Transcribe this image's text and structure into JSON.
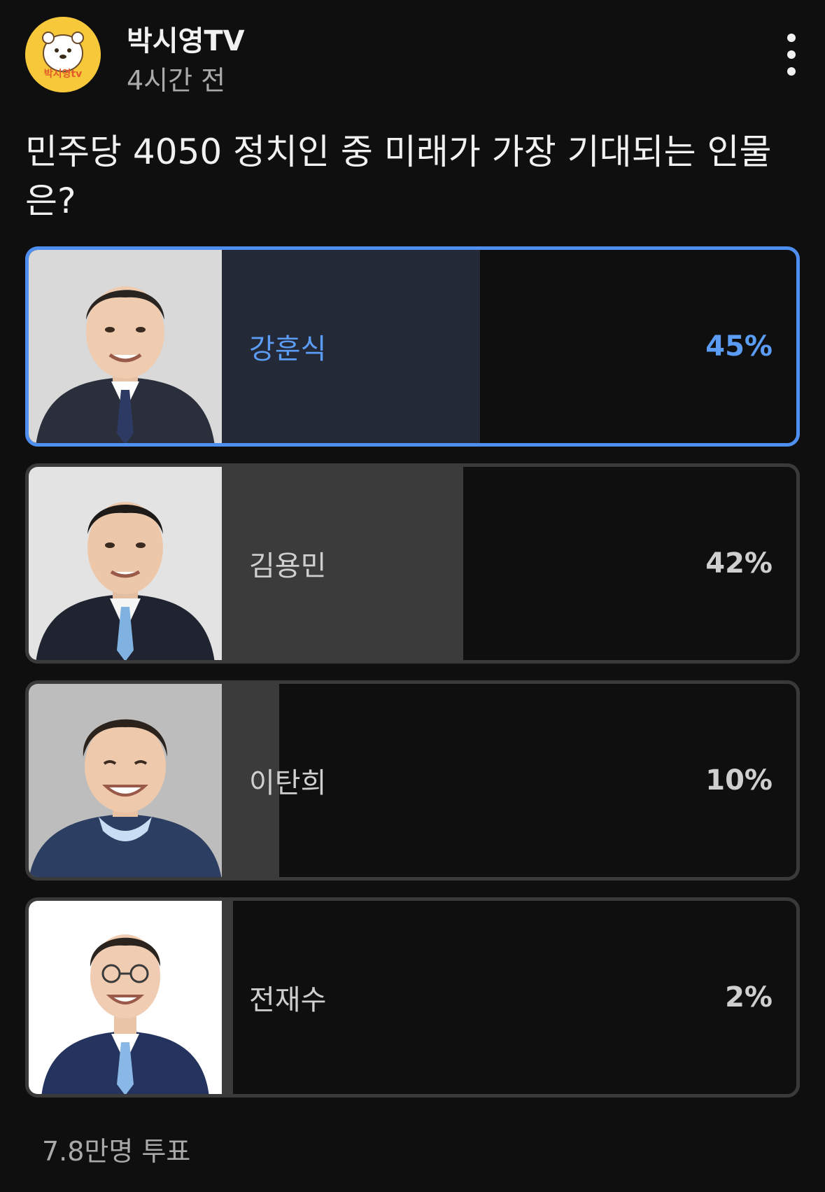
{
  "post": {
    "channel_name": "박시영TV",
    "time": "4시간 전",
    "avatar_icon": "hamster-logo-icon",
    "avatar_logo_text": "박시영tv",
    "menu_icon": "more-vert-icon",
    "question": "민주당 4050 정치인 중 미래가 가장 기대되는 인물은?"
  },
  "poll": {
    "options": [
      {
        "name": "강훈식",
        "percent": "45%",
        "fill_fraction": 0.45,
        "selected": true
      },
      {
        "name": "김용민",
        "percent": "42%",
        "fill_fraction": 0.42,
        "selected": false
      },
      {
        "name": "이탄희",
        "percent": "10%",
        "fill_fraction": 0.1,
        "selected": false
      },
      {
        "name": "전재수",
        "percent": "2%",
        "fill_fraction": 0.02,
        "selected": false
      }
    ],
    "vote_count": "7.8만명 투표"
  },
  "colors": {
    "background": "#0f0f0f",
    "selected_accent": "#5b9cf5",
    "avatar_yellow": "#f6c83a"
  }
}
